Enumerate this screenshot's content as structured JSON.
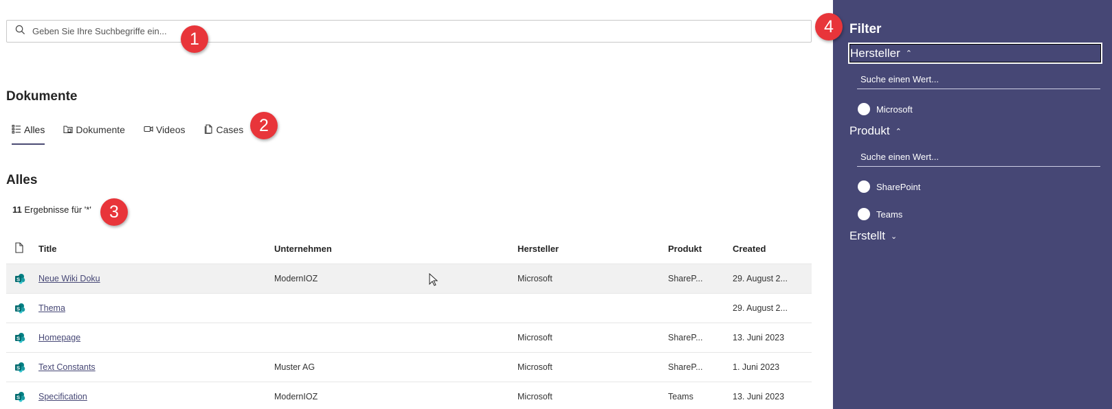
{
  "search": {
    "placeholder": "Geben Sie Ihre Suchbegriffe ein..."
  },
  "badges": {
    "b1": "1",
    "b2": "2",
    "b3": "3",
    "b4": "4"
  },
  "vertical_title": "Dokumente",
  "tabs": [
    {
      "label": "Alles",
      "icon": "list-icon",
      "active": true
    },
    {
      "label": "Dokumente",
      "icon": "documents-icon",
      "active": false
    },
    {
      "label": "Videos",
      "icon": "video-icon",
      "active": false
    },
    {
      "label": "Cases",
      "icon": "case-icon",
      "active": false
    }
  ],
  "results": {
    "title": "Alles",
    "count": "11",
    "count_text": " Ergebnisse für '*'"
  },
  "table": {
    "headers": {
      "title": "Title",
      "company": "Unternehmen",
      "vendor": "Hersteller",
      "product": "Produkt",
      "created": "Created"
    },
    "rows": [
      {
        "title": "Neue Wiki Doku",
        "company": "ModernIOZ",
        "vendor": "Microsoft",
        "product": "ShareP...",
        "created": "29. August 2..."
      },
      {
        "title": "Thema",
        "company": "",
        "vendor": "",
        "product": "",
        "created": "29. August 2..."
      },
      {
        "title": "Homepage",
        "company": "",
        "vendor": "Microsoft",
        "product": "ShareP...",
        "created": "13. Juni 2023"
      },
      {
        "title": "Text Constants",
        "company": "Muster AG",
        "vendor": "Microsoft",
        "product": "ShareP...",
        "created": "1. Juni 2023"
      },
      {
        "title": "Specification",
        "company": "ModernIOZ",
        "vendor": "Microsoft",
        "product": "Teams",
        "created": "13. Juni 2023"
      }
    ]
  },
  "filter": {
    "title": "Filter",
    "vendor_group": {
      "label": "Hersteller",
      "search_placeholder": "Suche einen Wert...",
      "options": [
        "Microsoft"
      ]
    },
    "product_group": {
      "label": "Produkt",
      "search_placeholder": "Suche einen Wert...",
      "options": [
        "SharePoint",
        "Teams"
      ]
    },
    "created_group": {
      "label": "Erstellt"
    }
  },
  "colors": {
    "accent": "#464775",
    "badge": "#e8353a",
    "link": "#464775",
    "sp_green": "#036c70"
  }
}
